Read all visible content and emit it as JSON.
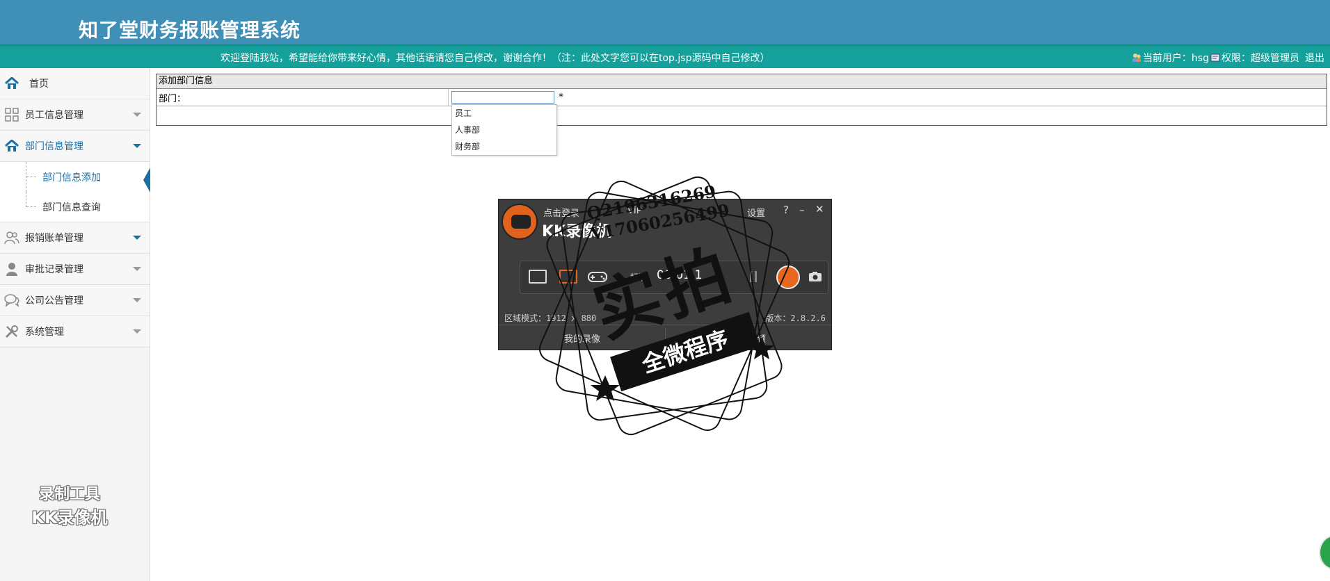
{
  "header": {
    "title": "知了堂财务报账管理系统"
  },
  "topbar": {
    "welcome": "欢迎登陆我站，希望能给你带来好心情，其他话语请您自己修改，谢谢合作！（注：此处文字您可以在top.jsp源码中自己修改）",
    "current_user": "当前用户：hsg",
    "permission": "权限：超级管理员",
    "logout": "退出"
  },
  "sidebar": {
    "items": [
      {
        "label": "首页",
        "icon": "home-icon"
      },
      {
        "label": "员工信息管理",
        "icon": "grid-icon"
      },
      {
        "label": "部门信息管理",
        "icon": "home-icon"
      },
      {
        "label": "报销账单管理",
        "icon": "users-icon"
      },
      {
        "label": "审批记录管理",
        "icon": "user-icon"
      },
      {
        "label": "公司公告管理",
        "icon": "chat-icon"
      },
      {
        "label": "系统管理",
        "icon": "tools-icon"
      }
    ],
    "subitems": [
      {
        "label": "部门信息添加"
      },
      {
        "label": "部门信息查询"
      }
    ]
  },
  "watermark_tool": {
    "line1": "录制工具",
    "line2": "KK录像机"
  },
  "form": {
    "title": "添加部门信息",
    "dept_label": "部门：",
    "dept_value": "",
    "required_mark": "*"
  },
  "dropdown": {
    "options": [
      "员工",
      "人事部",
      "财务部"
    ]
  },
  "recorder": {
    "brand": "KK录像机",
    "menu_record": "点击登录",
    "menu_vip": "VIP",
    "menu_settings": "设置",
    "help": "?",
    "minimize": "–",
    "close": "✕",
    "quality": "标清",
    "timer": "00:01:1",
    "mode": "区域模式：1912 x 880",
    "version": "版本：2.8.2.6",
    "my_recordings": "我的录像",
    "edit_video": "编辑视频"
  },
  "stamp": {
    "qq": "Q2196316269",
    "vx": "V17060256499",
    "big": "实拍",
    "ribbon": "全微程序"
  }
}
